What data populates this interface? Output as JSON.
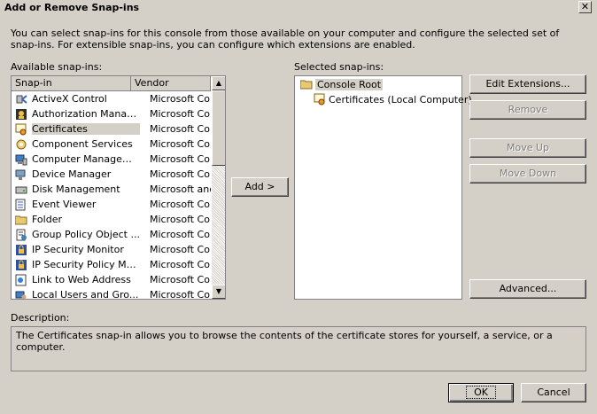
{
  "window": {
    "title": "Add or Remove Snap-ins",
    "close_label": "✕"
  },
  "intro_text": "You can select snap-ins for this console from those available on your computer and configure the selected set of snap-ins. For extensible snap-ins, you can configure which extensions are enabled.",
  "available": {
    "label": "Available snap-ins:",
    "columns": [
      "Snap-in",
      "Vendor"
    ],
    "selected_index": 2,
    "items": [
      {
        "name": "ActiveX Control",
        "vendor": "Microsoft Cor...",
        "icon": "activex-icon"
      },
      {
        "name": "Authorization Manager",
        "vendor": "Microsoft Cor...",
        "icon": "authorization-icon"
      },
      {
        "name": "Certificates",
        "vendor": "Microsoft Cor...",
        "icon": "certificate-icon"
      },
      {
        "name": "Component Services",
        "vendor": "Microsoft Cor...",
        "icon": "component-services-icon"
      },
      {
        "name": "Computer Managem...",
        "vendor": "Microsoft Cor...",
        "icon": "computer-management-icon"
      },
      {
        "name": "Device Manager",
        "vendor": "Microsoft Cor...",
        "icon": "device-manager-icon"
      },
      {
        "name": "Disk Management",
        "vendor": "Microsoft and...",
        "icon": "disk-icon"
      },
      {
        "name": "Event Viewer",
        "vendor": "Microsoft Cor...",
        "icon": "event-viewer-icon"
      },
      {
        "name": "Folder",
        "vendor": "Microsoft Cor...",
        "icon": "folder-icon"
      },
      {
        "name": "Group Policy Object ...",
        "vendor": "Microsoft Cor...",
        "icon": "group-policy-icon"
      },
      {
        "name": "IP Security Monitor",
        "vendor": "Microsoft Cor...",
        "icon": "ip-security-icon"
      },
      {
        "name": "IP Security Policy Ma...",
        "vendor": "Microsoft Cor...",
        "icon": "ip-security-icon"
      },
      {
        "name": "Link to Web Address",
        "vendor": "Microsoft Cor...",
        "icon": "web-link-icon"
      },
      {
        "name": "Local Users and Gro...",
        "vendor": "Microsoft Cor...",
        "icon": "users-icon"
      }
    ]
  },
  "add_button": "Add >",
  "selected": {
    "label": "Selected snap-ins:",
    "root": "Console Root",
    "children": [
      "Certificates (Local Computer)"
    ]
  },
  "buttons": {
    "edit_extensions": "Edit Extensions...",
    "remove": "Remove",
    "move_up": "Move Up",
    "move_down": "Move Down",
    "advanced": "Advanced...",
    "ok": "OK",
    "cancel": "Cancel"
  },
  "description": {
    "label": "Description:",
    "text": "The Certificates snap-in allows you to browse the contents of the certificate stores for yourself, a service, or a computer."
  },
  "colors": {
    "dialog_bg": "#d4d0c8",
    "border": "#848284",
    "disabled_text": "#808080"
  }
}
